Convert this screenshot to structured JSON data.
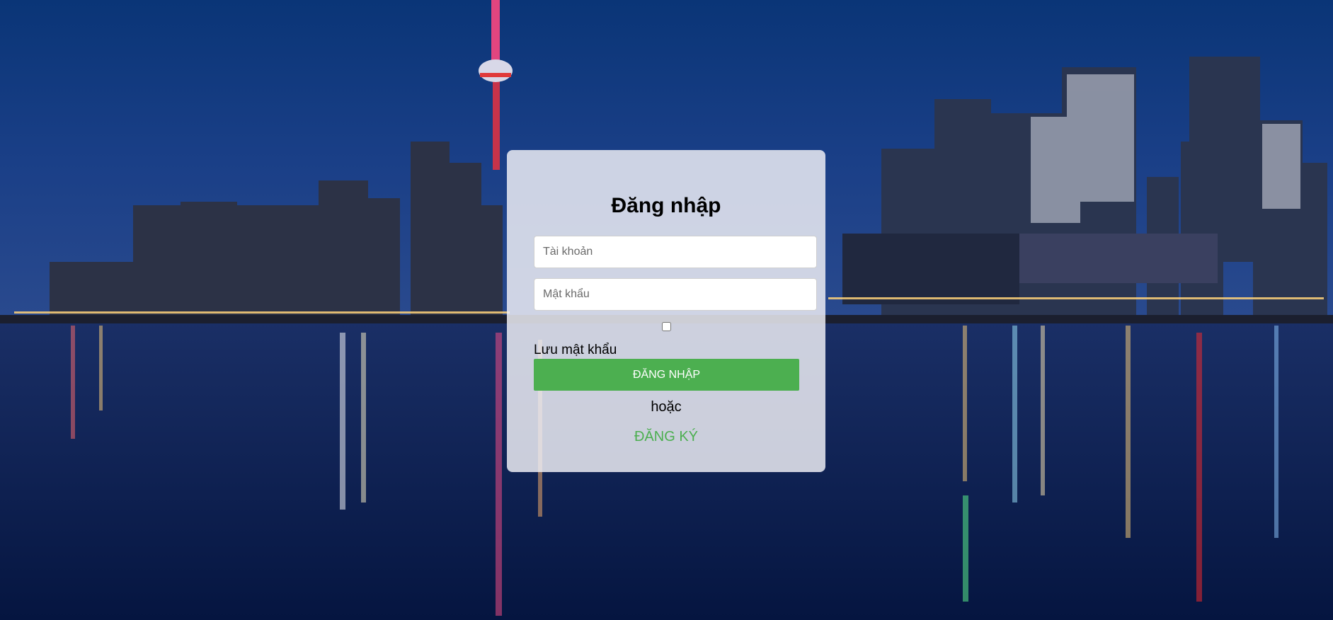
{
  "background": {
    "description_icon": "city-skyline-night-photo-icon",
    "sky_color_top": "#0d3a7a",
    "sky_color_horizon": "#1f3f8a",
    "water_color": "#061a4a"
  },
  "login_form": {
    "title": "Đăng nhập",
    "username_placeholder": "Tài khoản",
    "password_placeholder": "Mật khẩu",
    "remember_checked": false,
    "remember_label": "Lưu mật khẩu",
    "login_button_label": "ĐĂNG NHẬP",
    "or_text": "hoặc",
    "register_link_label": "ĐĂNG KÝ",
    "accent_color": "#4caf50"
  }
}
